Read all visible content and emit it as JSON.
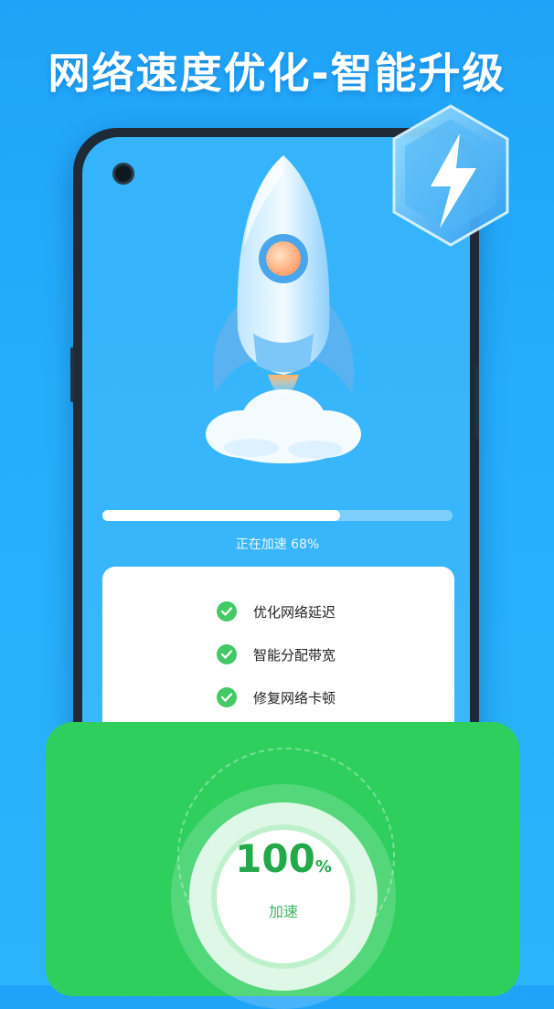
{
  "headline": "网络速度优化-智能升级",
  "progress": {
    "label": "正在加速 68%",
    "value": 0.68
  },
  "checklist": [
    {
      "label": "优化网络延迟",
      "icon": "check-icon"
    },
    {
      "label": "智能分配带宽",
      "icon": "check-icon"
    },
    {
      "label": "修复网络卡顿",
      "icon": "check-icon"
    }
  ],
  "result": {
    "percent": "100",
    "unit": "%",
    "label": "加速"
  },
  "icons": {
    "badge": "lightning-bolt-icon",
    "rocket": "rocket-icon",
    "camera": "camera-icon"
  },
  "colors": {
    "background": "#25aefb",
    "accent_green": "#2fcf5e",
    "percent_text": "#22a94a"
  }
}
